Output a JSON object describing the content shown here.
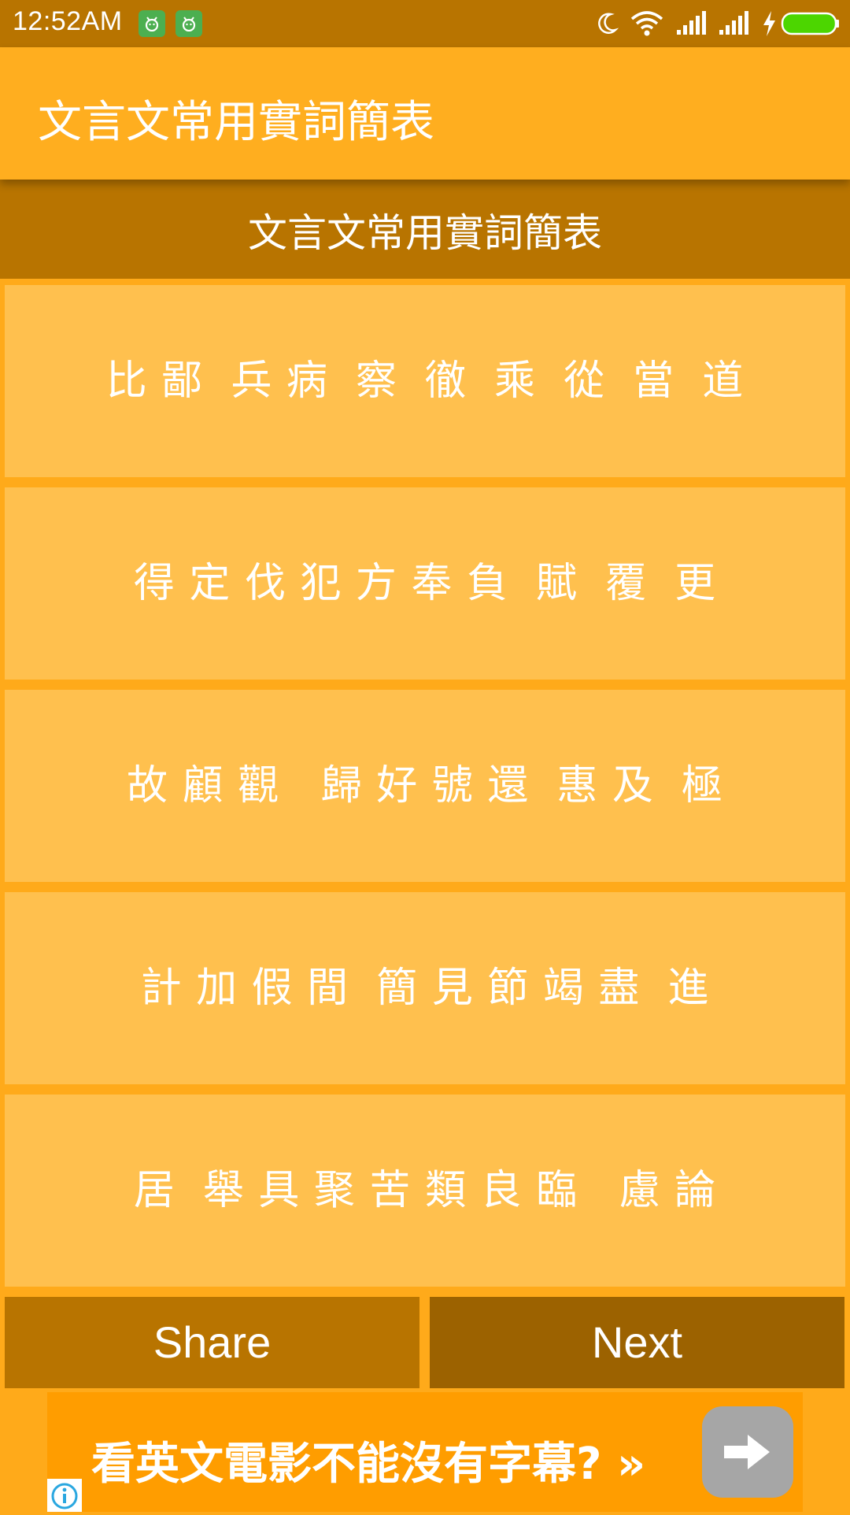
{
  "status_bar": {
    "time": "12:52AM",
    "icons": [
      "android-notification-icon",
      "android-notification-icon",
      "moon-icon",
      "wifi-icon",
      "signal-icon",
      "signal-icon",
      "charging-bolt-icon",
      "battery-icon"
    ],
    "battery_color": "#4CD600"
  },
  "app_bar": {
    "title": "文言文常用實詞簡表"
  },
  "sub_header": {
    "title": "文言文常用實詞簡表"
  },
  "word_rows": [
    "比 鄙  兵 病  察  徹  乘  從  當  道",
    "得 定 伐 犯 方 奉 負  賦  覆  更",
    "故 顧 觀   歸 好 號 還  惠 及  極",
    "計 加 假 間  簡 見 節 竭 盡  進",
    "居  舉 具 聚 苦 類 良 臨   慮 論"
  ],
  "buttons": {
    "share": "Share",
    "next": "Next"
  },
  "ad": {
    "text": "看英文電影不能沒有字幕? »",
    "arrow_icon": "arrow-right-icon",
    "info_icon": "info-icon"
  },
  "colors": {
    "status_bar": "#B87400",
    "app_bar": "#FFAE1F",
    "sub_header": "#B87400",
    "row_background": "#FFC04E",
    "share_button": "#B87400",
    "next_button": "#9C6200",
    "ad_background": "#FF9D00"
  }
}
